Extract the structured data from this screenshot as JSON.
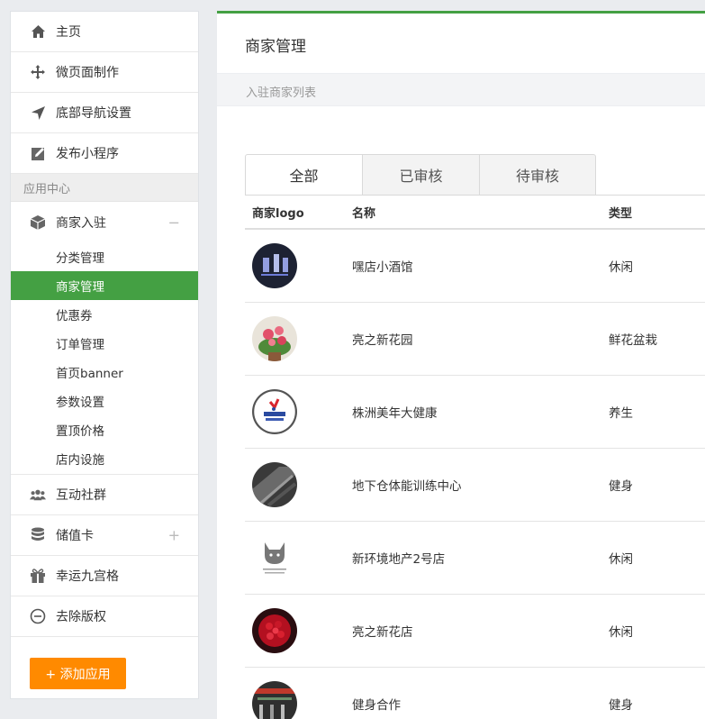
{
  "sidebar": {
    "top_items": [
      {
        "label": "主页",
        "icon": "home-icon"
      },
      {
        "label": "微页面制作",
        "icon": "move-icon"
      },
      {
        "label": "底部导航设置",
        "icon": "navigation-arrow-icon"
      },
      {
        "label": "发布小程序",
        "icon": "edit-square-icon"
      }
    ],
    "section_label": "应用中心",
    "merchant_group": {
      "label": "商家入驻",
      "icon": "cube-icon",
      "toggle": "−"
    },
    "sub_items": [
      "分类管理",
      "商家管理",
      "优惠券",
      "订单管理",
      "首页banner",
      "参数设置",
      "置顶价格",
      "店内设施"
    ],
    "active_sub": "商家管理",
    "bottom_items": [
      {
        "label": "互动社群",
        "icon": "users-icon",
        "trail": ""
      },
      {
        "label": "储值卡",
        "icon": "database-icon",
        "trail": "+"
      },
      {
        "label": "幸运九宫格",
        "icon": "gift-icon",
        "trail": ""
      },
      {
        "label": "去除版权",
        "icon": "minus-circle-icon",
        "trail": ""
      }
    ],
    "add_button": "+ 添加应用"
  },
  "colors": {
    "accent_green": "#44a043",
    "add_orange": "#ff8a00"
  },
  "main": {
    "title": "商家管理",
    "breadcrumb": "入驻商家列表",
    "tabs": [
      "全部",
      "已审核",
      "待审核"
    ],
    "active_tab": "全部",
    "table": {
      "headers": {
        "logo": "商家logo",
        "name": "名称",
        "type": "类型"
      },
      "rows": [
        {
          "name": "嘿店小酒馆",
          "type": "休闲",
          "logo": "bar-logo"
        },
        {
          "name": "亮之新花园",
          "type": "鲜花盆栽",
          "logo": "flower-logo"
        },
        {
          "name": "株洲美年大健康",
          "type": "养生",
          "logo": "health-logo"
        },
        {
          "name": "地下仓体能训练中心",
          "type": "健身",
          "logo": "gym-logo"
        },
        {
          "name": "新环境地产2号店",
          "type": "休闲",
          "logo": "cat-logo"
        },
        {
          "name": "亮之新花店",
          "type": "休闲",
          "logo": "roses-logo"
        },
        {
          "name": "健身合作",
          "type": "健身",
          "logo": "fitness-logo"
        }
      ]
    }
  }
}
